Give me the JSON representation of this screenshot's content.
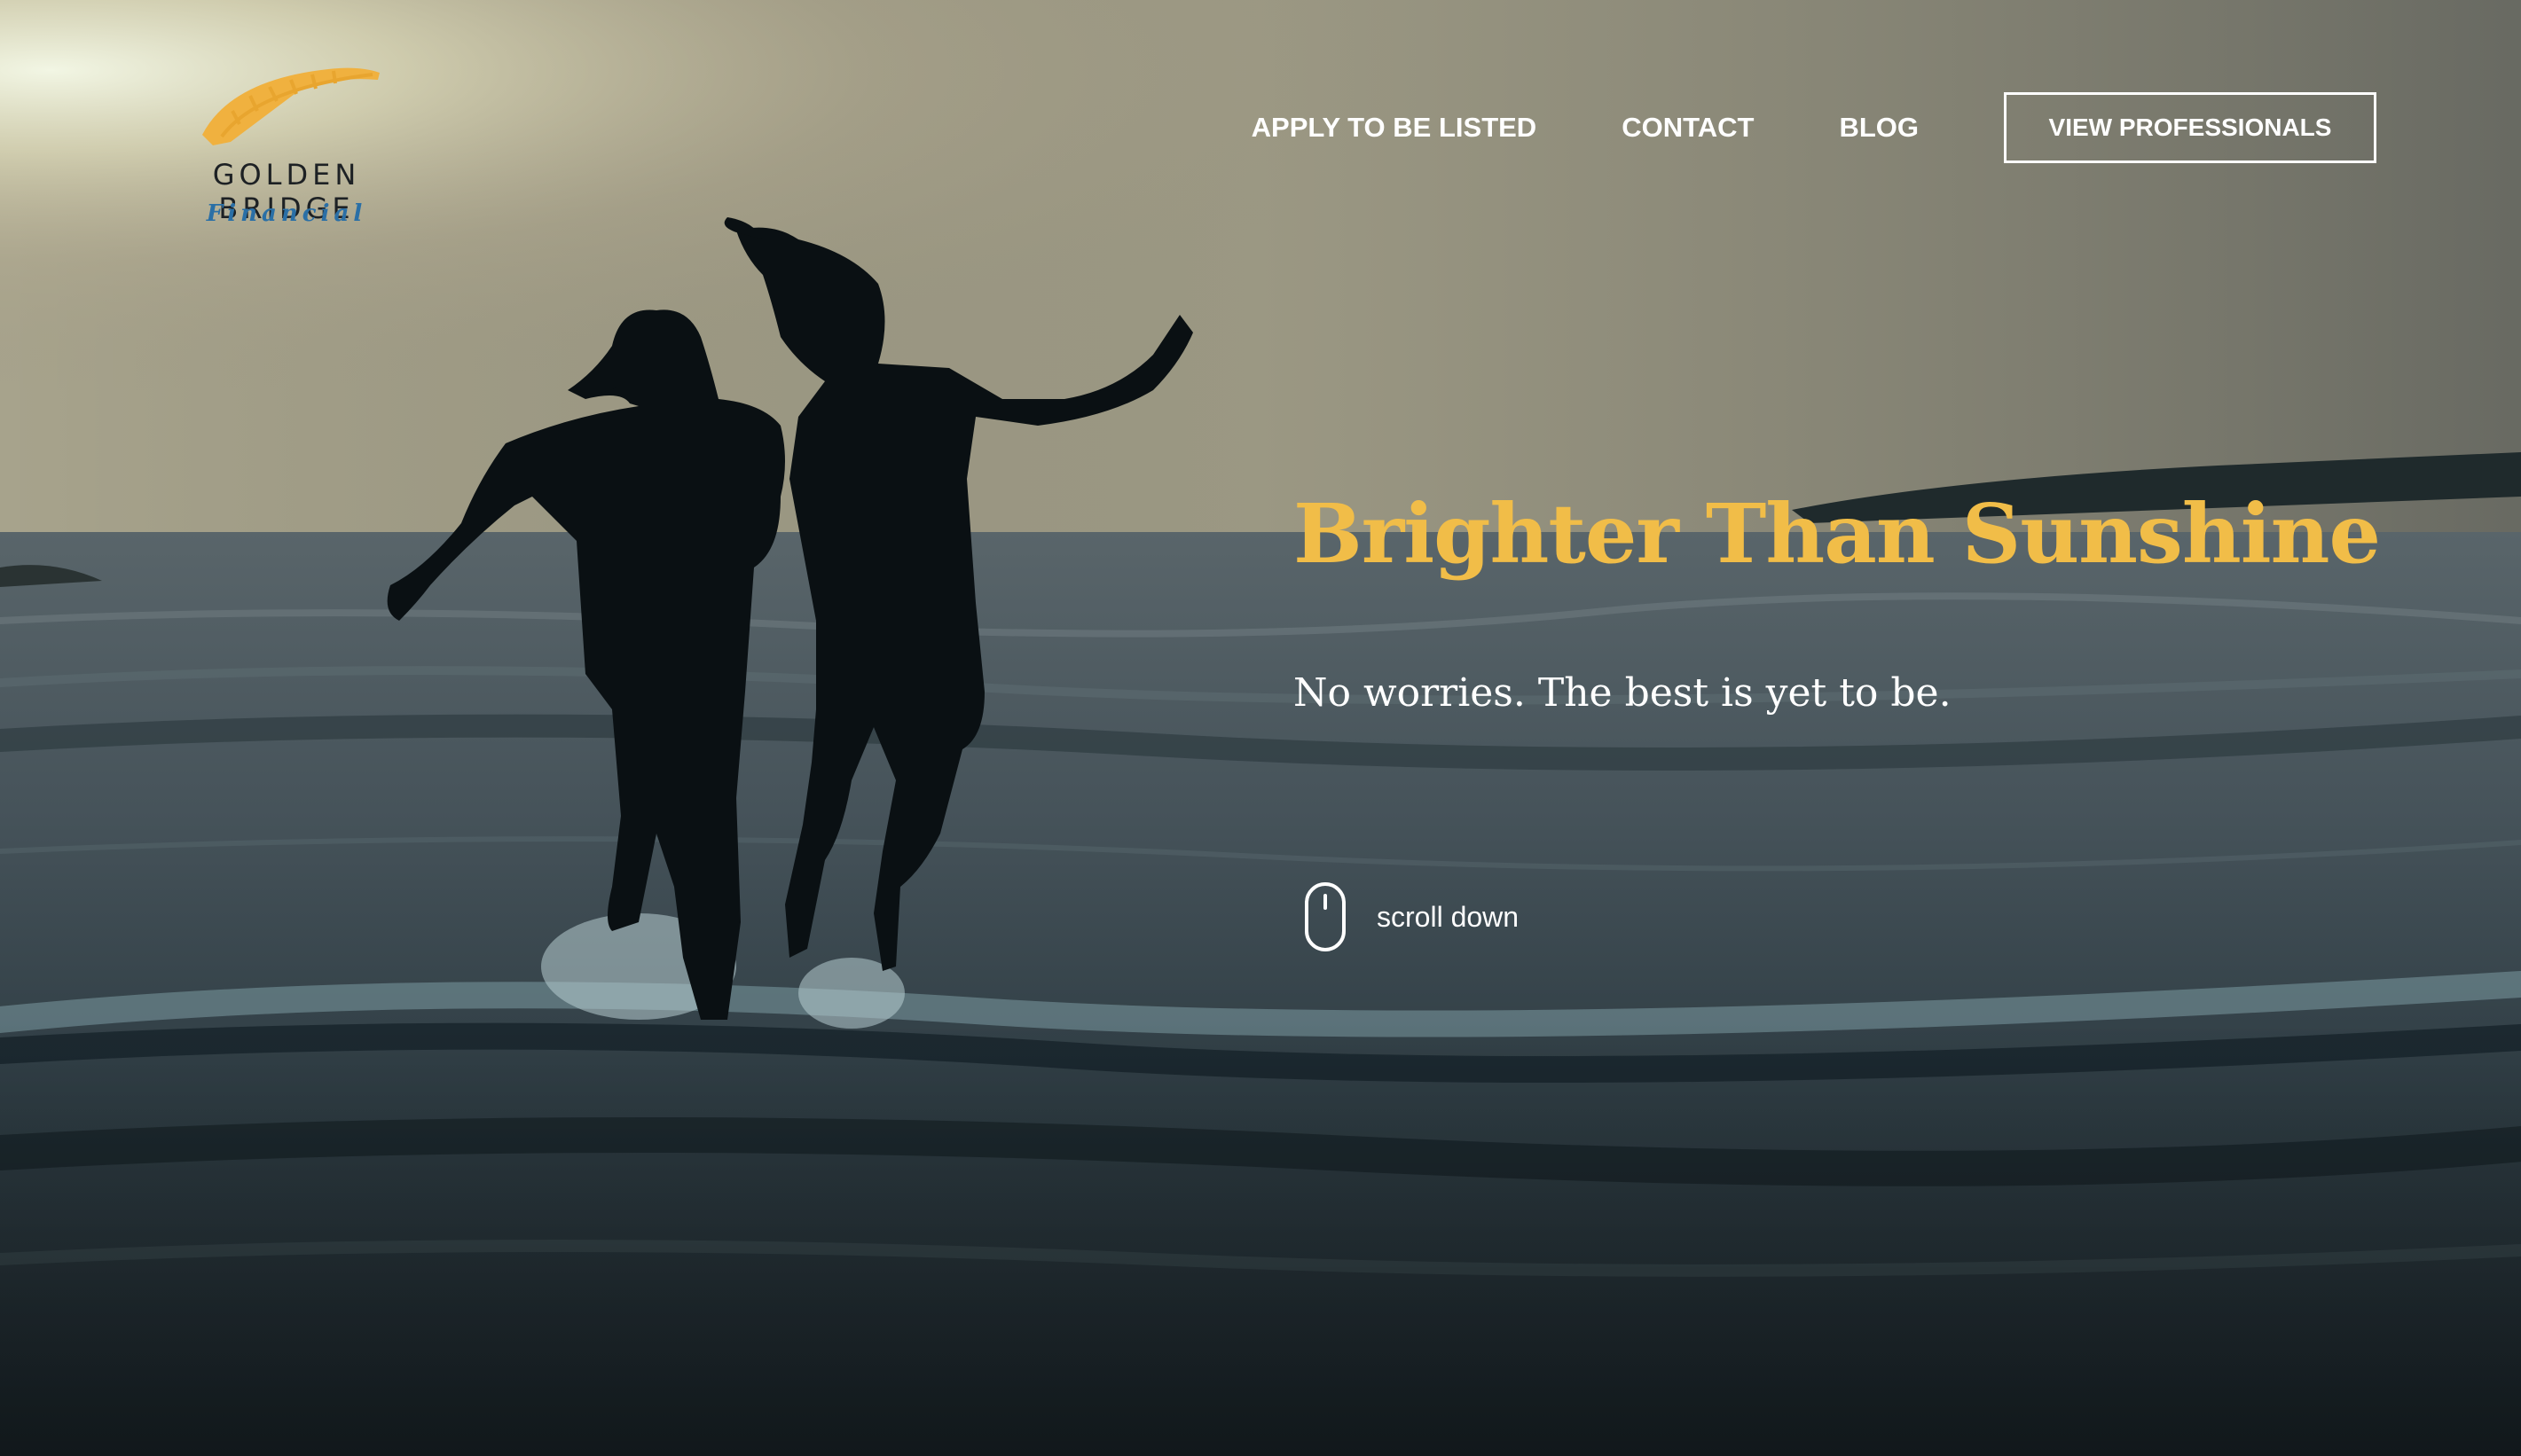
{
  "brand": {
    "name": "GOLDEN BRIDGE",
    "tagline": "Financial",
    "logo_color": "#f0b13f",
    "tagline_color": "#2a6fa6"
  },
  "nav": {
    "links": [
      {
        "label": "APPLY TO BE LISTED"
      },
      {
        "label": "CONTACT"
      },
      {
        "label": "BLOG"
      }
    ],
    "cta_label": "VIEW PROFESSIONALS"
  },
  "hero": {
    "headline": "Brighter Than Sunshine",
    "headline_color": "#f1bd48",
    "subheadline": "No worries. The best is yet to be.",
    "scroll_label": "scroll down",
    "scroll_icon": "mouse-icon"
  }
}
